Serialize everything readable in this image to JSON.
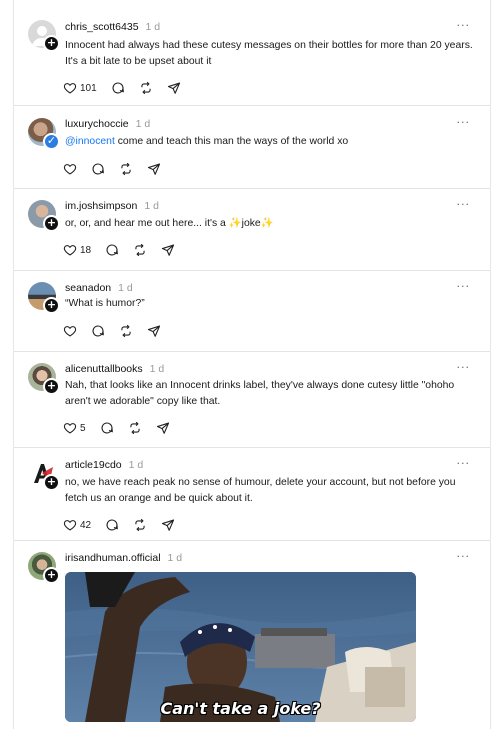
{
  "posts": [
    {
      "username": "chris_scott6435",
      "time": "1 d",
      "body": "Innocent had always had these cutesy messages on their bottles for more than 20 years. It's a bit late to be upset about it",
      "likes": "101"
    },
    {
      "username": "luxurychoccie",
      "time": "1 d",
      "mention": "@innocent",
      "body": " come and teach this man the ways of the world xo",
      "likes": ""
    },
    {
      "username": "im.joshsimpson",
      "time": "1 d",
      "body": "or, or, and hear me out here... it's a ✨joke✨",
      "likes": "18"
    },
    {
      "username": "seanadon",
      "time": "1 d",
      "body": "“What is humor?”",
      "likes": ""
    },
    {
      "username": "alicenuttallbooks",
      "time": "1 d",
      "body": "Nah, that looks like an Innocent drinks label, they've always done cutesy little \"ohoho aren't we adorable\" copy like that.",
      "likes": "5"
    },
    {
      "username": "article19cdo",
      "time": "1 d",
      "body": "no, we have reach peak no sense of humour, delete your account, but not before you fetch us an orange and be quick about it.",
      "likes": "42"
    },
    {
      "username": "irisandhuman.official",
      "time": "1 d",
      "media_caption": "Can't take a joke?"
    }
  ],
  "more_label": "···",
  "colors": {
    "mention": "#1877f2",
    "divider": "#e4e4e4",
    "muted": "#9a9a9a"
  },
  "icons": [
    "heart-icon",
    "comment-icon",
    "repost-icon",
    "share-icon",
    "more-icon",
    "follow-plus-icon"
  ]
}
